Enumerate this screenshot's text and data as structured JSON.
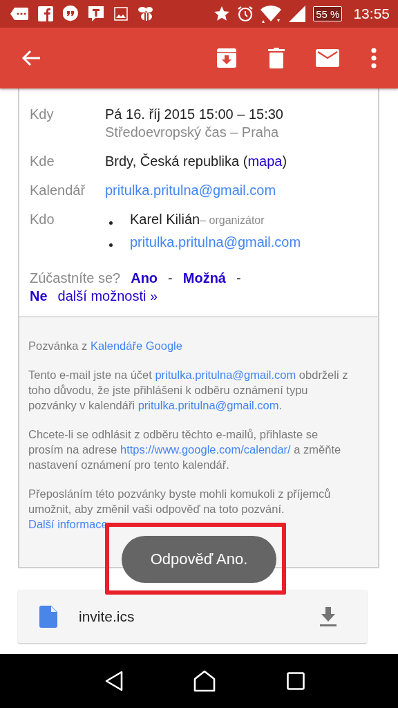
{
  "status_bar": {
    "battery": "55 %",
    "time": "13:55"
  },
  "event": {
    "rows": [
      {
        "label": "Kdy",
        "bullets": false,
        "lines": [
          [
            {
              "text": "Pá 16. říj 2015 15:00 – 15:30",
              "kind": "plain"
            }
          ],
          [
            {
              "text": "Středoevropský čas – Praha",
              "kind": "muted"
            }
          ]
        ]
      },
      {
        "label": "Kde",
        "bullets": false,
        "lines": [
          [
            {
              "text": "Brdy, Česká republika (",
              "kind": "plain"
            },
            {
              "text": "mapa",
              "kind": "anchor"
            },
            {
              "text": ")",
              "kind": "plain"
            }
          ]
        ]
      },
      {
        "label": "Kalendář",
        "bullets": false,
        "lines": [
          [
            {
              "text": "pritulka.pritulna@gmail.com",
              "kind": "link"
            }
          ]
        ]
      },
      {
        "label": "Kdo",
        "bullets": true,
        "lines": [
          [
            {
              "text": "Karel Kilián",
              "kind": "plain"
            },
            {
              "text": "– organizátor",
              "kind": "note"
            }
          ],
          [
            {
              "text": "pritulka.pritulna@gmail.com",
              "kind": "link"
            }
          ]
        ]
      }
    ],
    "rsvp": [
      {
        "text": "Zúčastníte se?",
        "kind": "prompt"
      },
      {
        "text": "Ano",
        "kind": "option"
      },
      {
        "text": "-",
        "kind": "separator"
      },
      {
        "text": "Možná",
        "kind": "option"
      },
      {
        "text": "-",
        "kind": "separator"
      },
      {
        "text": "Ne",
        "kind": "option"
      },
      {
        "text": "další možnosti »",
        "kind": "more"
      }
    ]
  },
  "footer": {
    "paragraphs": [
      [
        {
          "text": "Pozvánka z ",
          "kind": "plain"
        },
        {
          "text": "Kalendáře Google",
          "kind": "link"
        }
      ],
      [
        {
          "text": "Tento e-mail jste na účet ",
          "kind": "plain"
        },
        {
          "text": "pritulka.pritulna@gmail.com",
          "kind": "link"
        },
        {
          "text": " obdrželi z toho důvodu, že jste přihlášeni k odběru oznámení typu pozvánky v kalendáři ",
          "kind": "plain"
        },
        {
          "text": "pritulka.pritulna@gmail.com",
          "kind": "link"
        },
        {
          "text": ".",
          "kind": "plain"
        }
      ],
      [
        {
          "text": "Chcete-li se odhlásit z odběru těchto e-mailů, přihlaste se prosím na adrese ",
          "kind": "plain"
        },
        {
          "text": "https://www.google.com/calendar/",
          "kind": "link"
        },
        {
          "text": " a změňte nastavení oznámení pro tento kalendář.",
          "kind": "plain"
        }
      ],
      [
        {
          "text": "Přeposláním této pozvánky byste mohli komukoli z příjemců umožnit, aby změnil vaši odpověď na toto pozvání. ",
          "kind": "plain"
        },
        {
          "text": "Další informace",
          "kind": "link"
        }
      ]
    ]
  },
  "attachment": {
    "name": "invite.ics"
  },
  "toast": {
    "text": "Odpověď Ano."
  }
}
